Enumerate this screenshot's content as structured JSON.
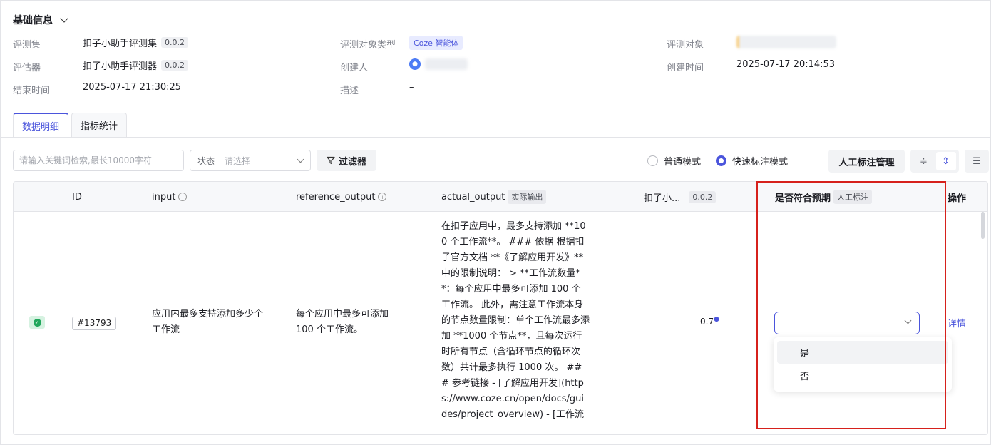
{
  "info": {
    "section_title": "基础信息",
    "labels": {
      "eval_set": "评测集",
      "evaluator": "评估器",
      "end_time": "结束时间",
      "target_type": "评测对象类型",
      "creator": "创建人",
      "description": "描述",
      "target": "评测对象",
      "create_time": "创建时间"
    },
    "values": {
      "eval_set_name": "扣子小助手评测集",
      "eval_set_version": "0.0.2",
      "evaluator_name": "扣子小助手评测器",
      "evaluator_version": "0.0.2",
      "end_time": "2025-07-17 21:30:25",
      "target_type": "Coze 智能体",
      "description": "–",
      "create_time": "2025-07-17 20:14:53"
    }
  },
  "tabs": [
    "数据明细",
    "指标统计"
  ],
  "toolbar": {
    "search_placeholder": "请输入关键词检索,最长10000字符",
    "status_label": "状态",
    "status_placeholder": "请选择",
    "filter_label": "过滤器",
    "mode_normal": "普通模式",
    "mode_fast": "快速标注模式",
    "selected_mode": "快速标注模式",
    "manage_label": "人工标注管理"
  },
  "table": {
    "headers": {
      "id": "ID",
      "input": "input",
      "reference_output": "reference_output",
      "actual_output": "actual_output",
      "actual_output_tag": "实际输出",
      "evaluator": "扣子小...",
      "evaluator_tag": "0.0.2",
      "expected": "是否符合预期",
      "expected_tag": "人工标注",
      "action": "操作"
    },
    "rows": [
      {
        "status": "success",
        "id": "#13793",
        "input": "应用内最多支持添加多少个工作流",
        "reference_output": "每个应用中最多可添加 100 个工作流。",
        "actual_output": "在扣子应用中，最多支持添加 **100 个工作流**。 ### 依据 根据扣子官方文档 **《了解应用开发》**中的限制说明： > **工作流数量**：每个应用中最多可添加 100 个工作流。 此外，需注意工作流本身的节点数量限制：单个工作流最多添加 **1000 个节点**，且每次运行时所有节点（含循环节点的循环次数）共计最多执行 1000 次。 ### 参考链接 - [了解应用开发](https://www.coze.cn/open/docs/guides/project_overview) - [工作流",
        "score": "0.7",
        "expected_value": "",
        "action": "详情"
      }
    ]
  },
  "dropdown": {
    "options": [
      "是",
      "否"
    ],
    "hovered": "是"
  },
  "colors": {
    "accent": "#4b55dc",
    "highlight_box": "#d6211c",
    "success": "#22a75c"
  }
}
